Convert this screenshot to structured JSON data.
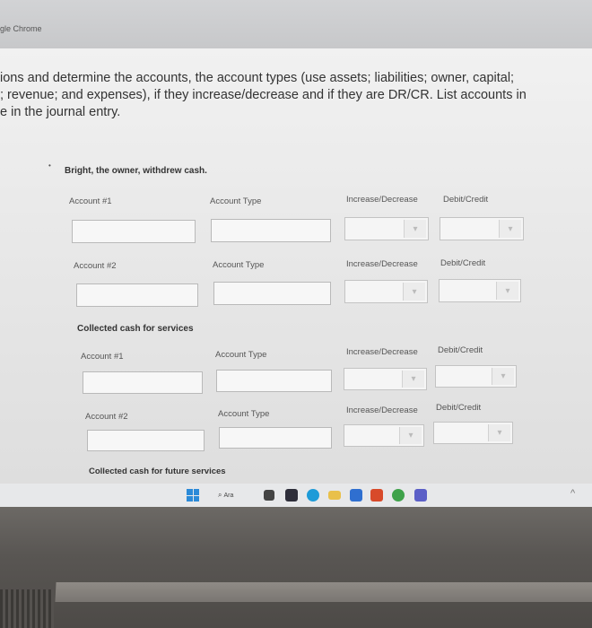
{
  "window": {
    "app_title": "gle Chrome"
  },
  "instructions": "ions and determine the accounts, the account types (use assets; liabilities; owner, capital;\n; revenue; and expenses), if they increase/decrease and if they are DR/CR. List accounts in\ne in the journal entry.",
  "bullet": "•",
  "scenarios": [
    {
      "title": "Bright, the owner, withdrew cash."
    },
    {
      "title": "Collected cash for services"
    },
    {
      "title": "Collected cash for future services"
    }
  ],
  "labels": {
    "s1": {
      "a1": "Account #1",
      "type1": "Account Type",
      "incdec1": "Increase/Decrease",
      "drcr1": "Debit/Credit",
      "a2": "Account #2",
      "type2": "Account Type",
      "incdec2": "Increase/Decrease",
      "drcr2": "Debit/Credit"
    },
    "s2": {
      "a1": "Account #1",
      "type1": "Account Type",
      "incdec1": "Increase/Decrease",
      "drcr1": "Debit/Credit",
      "a2": "Account #2",
      "type2": "Account Type",
      "incdec2": "Increase/Decrease",
      "drcr2": "Debit/Credit"
    }
  },
  "dropdown_chevron": "▾",
  "taskbar": {
    "search_placeholder": "Ara",
    "search_icon": "magnifier-icon",
    "tray_chevron": "^"
  },
  "colors": {
    "screen_bg": "#ececec",
    "windows_logo": "#2b8ad8",
    "taskbar_bg": "#e7e8ea"
  }
}
